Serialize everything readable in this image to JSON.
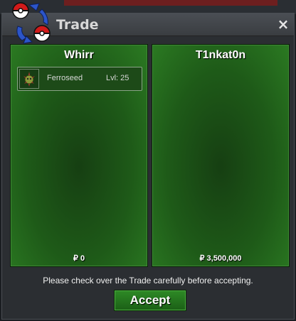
{
  "window": {
    "title": "Trade",
    "close_icon": "×"
  },
  "left_player": {
    "name": "Whirr",
    "items": [
      {
        "name": "Ferroseed",
        "level": "Lvl: 25",
        "icon": "ferroseed-icon"
      }
    ],
    "money": "₽ 0"
  },
  "right_player": {
    "name": "T1nkat0n",
    "items": [],
    "money": "₽ 3,500,000"
  },
  "notice": "Please check over the Trade carefully before accepting.",
  "accept_label": "Accept",
  "colors": {
    "panel_green": "#1e5a18",
    "button_green": "#2e8a26",
    "window_bg": "#2b2e32"
  }
}
